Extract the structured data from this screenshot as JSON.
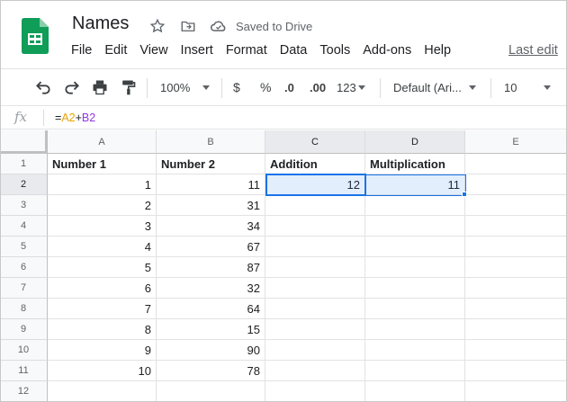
{
  "app": {
    "title": "Names",
    "saved_status": "Saved to Drive",
    "last_edit": "Last edit",
    "brand_color": "#0F9D58"
  },
  "menu": [
    "File",
    "Edit",
    "View",
    "Insert",
    "Format",
    "Data",
    "Tools",
    "Add-ons",
    "Help"
  ],
  "toolbar": {
    "zoom": "100%",
    "currency": "$",
    "percent": "%",
    "decrease_decimal": ".0",
    "increase_decimal": ".00",
    "more_formats": "123",
    "font": "Default (Ari...",
    "font_size": "10"
  },
  "formula_bar": {
    "fx": "fx",
    "formula_prefix": "=",
    "ref1": "A2",
    "op": "+",
    "ref2": "B2",
    "ref1_color": "#e8a200",
    "ref2_color": "#9334e6"
  },
  "columns": [
    "A",
    "B",
    "C",
    "D",
    "E"
  ],
  "rows": [
    "1",
    "2",
    "3",
    "4",
    "5",
    "6",
    "7",
    "8",
    "9",
    "10",
    "11",
    "12"
  ],
  "headers": {
    "a": "Number 1",
    "b": "Number 2",
    "c": "Addition",
    "d": "Multiplication"
  },
  "data": {
    "a": [
      "1",
      "2",
      "3",
      "4",
      "5",
      "6",
      "7",
      "8",
      "9",
      "10"
    ],
    "b": [
      "11",
      "31",
      "34",
      "67",
      "87",
      "32",
      "64",
      "15",
      "90",
      "78"
    ],
    "c2": "12",
    "d2": "11"
  },
  "selection_color": "#1a73e8"
}
